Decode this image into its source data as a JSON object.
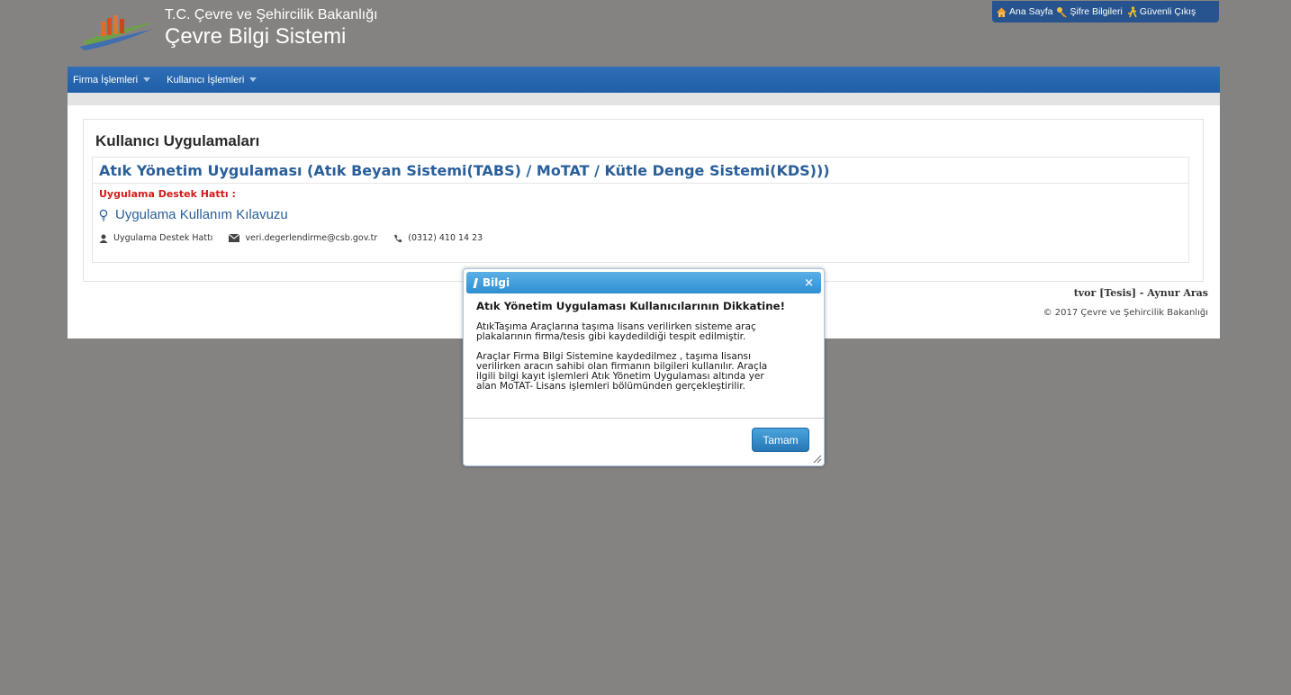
{
  "header": {
    "ministry": "T.C. Çevre ve Şehircilik Bakanlığı",
    "system_name": "Çevre Bilgi Sistemi",
    "links": [
      {
        "label": "Ana Sayfa",
        "icon": "home-icon"
      },
      {
        "label": "Şifre Bilgileri",
        "icon": "key-icon"
      },
      {
        "label": "Güvenli Çıkış",
        "icon": "exit-icon"
      }
    ]
  },
  "menu": {
    "items": [
      {
        "label": "Firma İşlemleri"
      },
      {
        "label": "Kullanıcı İşlemleri"
      }
    ]
  },
  "main": {
    "title": "Kullanıcı Uygulamaları",
    "app_title": "Atık Yönetim Uygulaması (Atık Beyan Sistemi(TABS) / MoTAT / Kütle Denge Sistemi(KDS)))",
    "support_title": "Uygulama Destek Hattı :",
    "guide_link": "Uygulama Kullanım Kılavuzu",
    "contact": {
      "name": "Uygulama Destek Hattı",
      "email": "veri.degerlendirme@csb.gov.tr",
      "phone": "(0312) 410 14 23"
    }
  },
  "footer": {
    "user": "tvor [Tesis] - Aynur Aras",
    "copyright": "© 2017 Çevre ve Şehircilik Bakanlığı"
  },
  "dialog": {
    "title": "Bilgi",
    "heading": "Atık Yönetim Uygulaması Kullanıcılarının Dikkatine!",
    "paragraph1_line1": "AtıkTaşıma Araçlarına taşıma lisans verilirken sisteme araç",
    "paragraph1_line2": "plakalarının firma/tesis gibi kaydedildiği tespit edilmiştir.",
    "paragraph2_line1": "Araçlar Firma Bilgi Sistemine kaydedilmez , taşıma lisansı",
    "paragraph2_line2": "verilirken aracın sahibi olan firmanın bilgileri kullanılır. Araçla",
    "paragraph2_line3": "ilgili bilgi kayıt işlemleri Atık Yönetim Uygulaması altında yer",
    "paragraph2_line4": "alan MoTAT- Lisans işlemleri bölümünden gerçekleştirilir.",
    "ok_label": "Tamam"
  },
  "colors": {
    "background": "#858381",
    "menubar": "#1f5ea8",
    "link": "#2a5f99",
    "support_red": "#d41b1b",
    "dialog_header": "#2f8fd0"
  }
}
